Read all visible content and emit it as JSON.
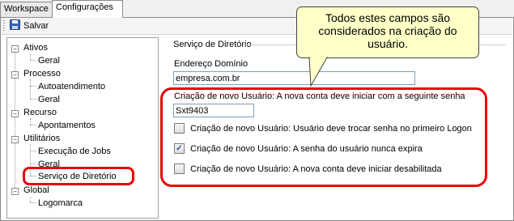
{
  "tabs": [
    {
      "label": "Workspace",
      "active": false
    },
    {
      "label": "Configurações",
      "active": true
    }
  ],
  "toolbar": {
    "save_label": "Salvar",
    "save_icon": "floppy-disk-icon"
  },
  "tree": {
    "items": [
      {
        "label": "Ativos",
        "level": 0,
        "expanded": true
      },
      {
        "label": "Geral",
        "level": 1
      },
      {
        "label": "Processo",
        "level": 0,
        "expanded": true
      },
      {
        "label": "Autoatendimento",
        "level": 1
      },
      {
        "label": "Geral",
        "level": 1
      },
      {
        "label": "Recurso",
        "level": 0,
        "expanded": true
      },
      {
        "label": "Apontamentos",
        "level": 1
      },
      {
        "label": "Utilitários",
        "level": 0,
        "expanded": true
      },
      {
        "label": "Execução de Jobs",
        "level": 1
      },
      {
        "label": "Geral",
        "level": 1
      },
      {
        "label": "Serviço de Diretório",
        "level": 1,
        "selected": true
      },
      {
        "label": "Global",
        "level": 0,
        "expanded": true
      },
      {
        "label": "Logomarca",
        "level": 1
      }
    ]
  },
  "panel": {
    "section_title": "Serviço de Diretório",
    "domain": {
      "label": "Endereço Domínio",
      "value": "empresa.com.br"
    },
    "password": {
      "label": "Criação de novo Usuário: A nova conta deve iniciar com a seguinte senha",
      "value": "Sxt9403"
    },
    "checkboxes": [
      {
        "label": "Criação de novo Usuário: Usuário deve trocar senha no primeiro Logon",
        "checked": false
      },
      {
        "label": "Criação de novo Usuário: A senha do usuário nunca expira",
        "checked": true
      },
      {
        "label": "Criação de novo Usuário: A nova conta deve iniciar desabilitada",
        "checked": false
      }
    ]
  },
  "callout": {
    "line1": "Todos estes campos são",
    "line2": "considerados na criação do",
    "line3": "usuário."
  },
  "colors": {
    "highlight": "#e8000b",
    "callout_bg": "#ffffc8",
    "check": "#214a8e"
  }
}
